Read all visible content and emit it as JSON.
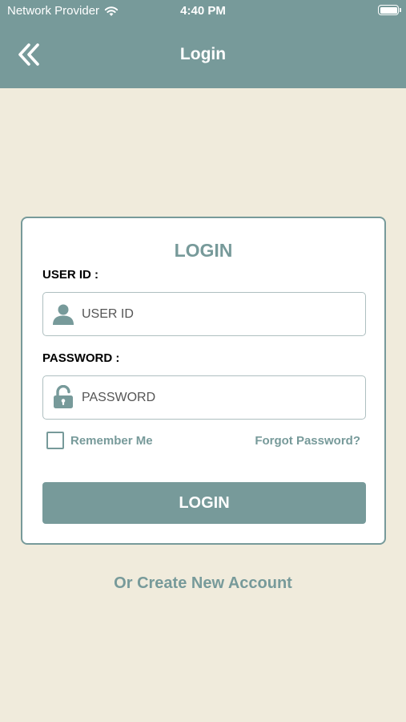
{
  "status_bar": {
    "carrier": "Network Provider",
    "time": "4:40 PM",
    "wifi_icon": "wifi-icon",
    "battery_icon": "battery-icon"
  },
  "header": {
    "title": "Login",
    "back_icon": "double-chevron-left-icon"
  },
  "login_card": {
    "title": "LOGIN",
    "user_id": {
      "label": "USER ID :",
      "placeholder": "USER ID",
      "value": "",
      "icon": "user-icon"
    },
    "password": {
      "label": "PASSWORD :",
      "placeholder": "PASSWORD",
      "value": "",
      "icon": "unlocked-padlock-icon"
    },
    "remember_me": {
      "label": "Remember Me",
      "checked": false
    },
    "forgot_password": "Forgot Password?",
    "login_button": "LOGIN"
  },
  "create_account": "Or Create New Account",
  "colors": {
    "primary": "#779a9a",
    "background": "#f0ebdc",
    "card": "#ffffff",
    "text": "#000000"
  }
}
